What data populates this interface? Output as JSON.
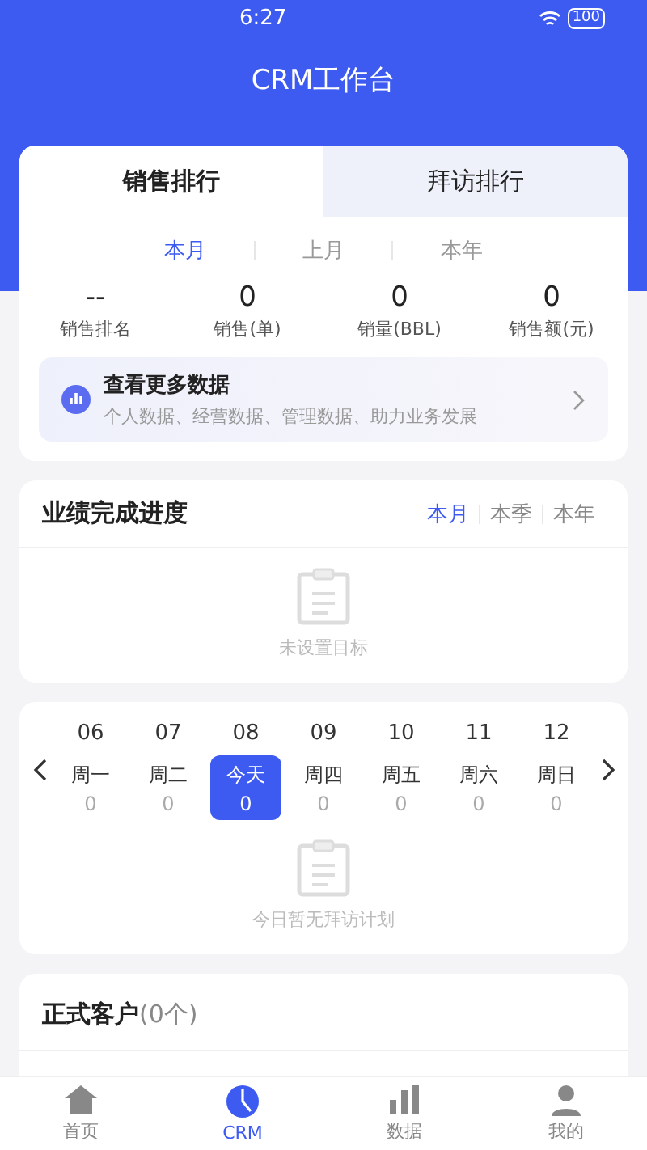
{
  "status_bar": {
    "time": "6:27",
    "battery": "100"
  },
  "header": {
    "title": "CRM工作台"
  },
  "ranking": {
    "tabs": [
      {
        "label": "销售排行",
        "selected": true
      },
      {
        "label": "拜访排行",
        "selected": false
      }
    ],
    "periods": [
      {
        "label": "本月",
        "selected": true
      },
      {
        "label": "上月",
        "selected": false
      },
      {
        "label": "本年",
        "selected": false
      }
    ],
    "stats": [
      {
        "value": "--",
        "label": "销售排名"
      },
      {
        "value": "0",
        "label": "销售(单)"
      },
      {
        "value": "0",
        "label": "销量(BBL)"
      },
      {
        "value": "0",
        "label": "销售额(元)"
      }
    ],
    "more": {
      "title": "查看更多数据",
      "subtitle": "个人数据、经营数据、管理数据、助力业务发展"
    }
  },
  "progress": {
    "title": "业绩完成进度",
    "periods": [
      {
        "label": "本月",
        "selected": true
      },
      {
        "label": "本季",
        "selected": false
      },
      {
        "label": "本年",
        "selected": false
      }
    ],
    "empty": "未设置目标"
  },
  "visits": {
    "days": [
      {
        "date": "06",
        "weekday": "周一",
        "count": "0",
        "selected": false
      },
      {
        "date": "07",
        "weekday": "周二",
        "count": "0",
        "selected": false
      },
      {
        "date": "08",
        "weekday": "今天",
        "count": "0",
        "selected": true
      },
      {
        "date": "09",
        "weekday": "周四",
        "count": "0",
        "selected": false
      },
      {
        "date": "10",
        "weekday": "周五",
        "count": "0",
        "selected": false
      },
      {
        "date": "11",
        "weekday": "周六",
        "count": "0",
        "selected": false
      },
      {
        "date": "12",
        "weekday": "周日",
        "count": "0",
        "selected": false
      }
    ],
    "empty": "今日暂无拜访计划"
  },
  "customers": {
    "title": "正式客户",
    "count": "(0个)"
  },
  "nav": [
    {
      "label": "首页",
      "kind": "home",
      "selected": false
    },
    {
      "label": "CRM",
      "kind": "pie",
      "selected": true
    },
    {
      "label": "数据",
      "kind": "data",
      "selected": false
    },
    {
      "label": "我的",
      "kind": "user",
      "selected": false
    }
  ]
}
